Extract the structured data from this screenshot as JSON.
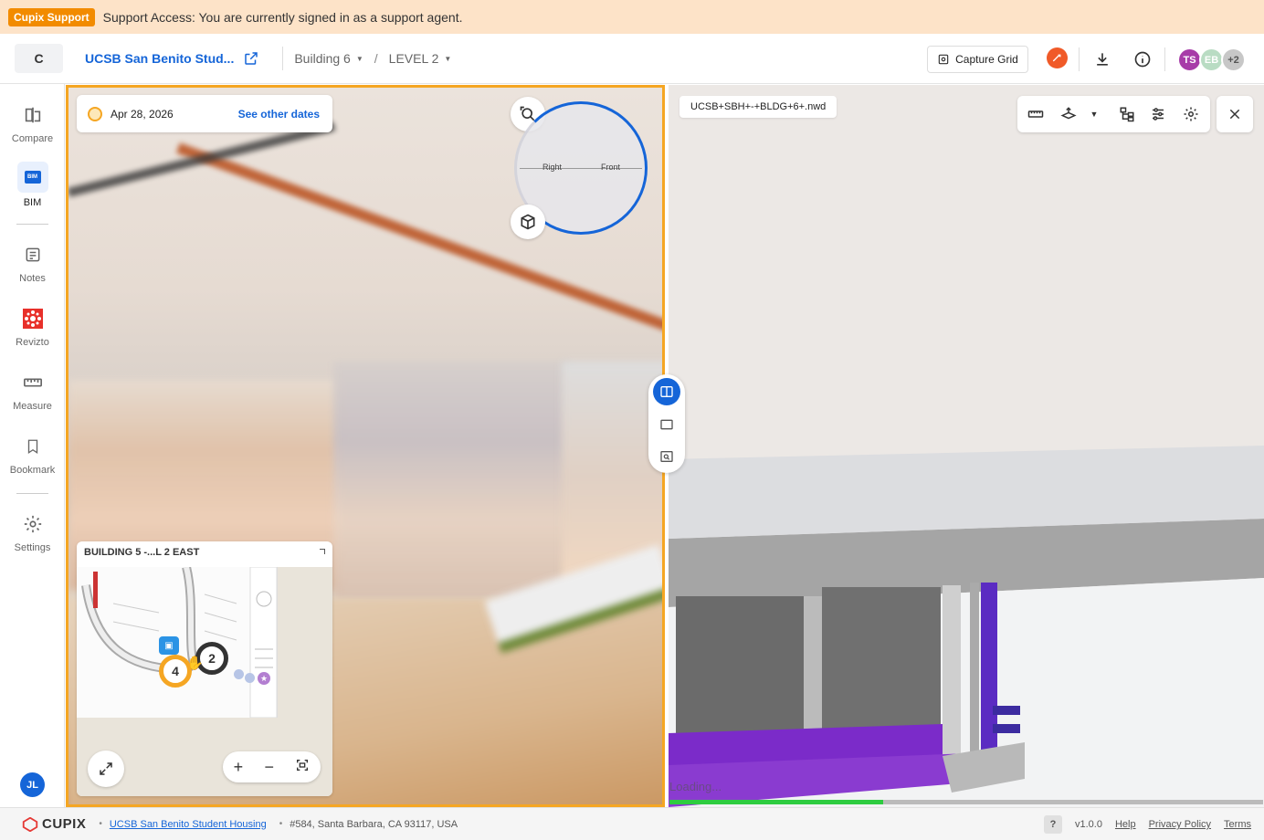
{
  "banner": {
    "badge": "Cupix Support",
    "message": "Support Access: You are currently signed in as a support agent."
  },
  "header": {
    "org_initial": "C",
    "project_name": "UCSB San Benito Stud...",
    "breadcrumb": {
      "building": "Building 6",
      "level": "LEVEL 2",
      "separator": "/"
    },
    "capture_grid_label": "Capture Grid",
    "avatars": [
      {
        "initials": "TS",
        "color": "#a73ca8"
      },
      {
        "initials": "EB",
        "color": "#b9dcc3"
      },
      {
        "initials": "+2",
        "color": "#c7c7c7"
      }
    ]
  },
  "sidebar": {
    "items": [
      {
        "label": "Compare",
        "icon": "compare-icon"
      },
      {
        "label": "BIM",
        "icon": "bim-icon",
        "badge": "BIM",
        "active": true
      },
      {
        "label": "Notes",
        "icon": "notes-icon"
      },
      {
        "label": "Revizto",
        "icon": "revizto-icon"
      },
      {
        "label": "Measure",
        "icon": "ruler-icon"
      },
      {
        "label": "Bookmark",
        "icon": "bookmark-icon"
      },
      {
        "label": "Settings",
        "icon": "gear-icon"
      }
    ],
    "user_initials": "JL"
  },
  "pano": {
    "date": "Apr 28, 2026",
    "other_dates_label": "See other dates",
    "compass": {
      "left_label": "Right",
      "right_label": "Front"
    }
  },
  "minimap": {
    "title": "BUILDING 5 -...L 2 EAST",
    "markers": [
      {
        "label": "2"
      },
      {
        "label": "4"
      }
    ]
  },
  "bim": {
    "file_name": "UCSB+SBH+-+BLDG+6+.nwd",
    "loading_text": "Loading...",
    "loading_progress": 0.36
  },
  "footer": {
    "brand": "CUPIX",
    "project_link": "UCSB San Benito Student Housing",
    "address": "#584, Santa Barbara, CA 93117, USA",
    "help_badge": "?",
    "version": "v1.0.0",
    "links": [
      "Help",
      "Privacy Policy",
      "Terms"
    ]
  },
  "colors": {
    "accent": "#1565d8",
    "pano_border": "#f5a623",
    "banner_bg": "#fde3c8",
    "banner_badge": "#f28b00"
  }
}
